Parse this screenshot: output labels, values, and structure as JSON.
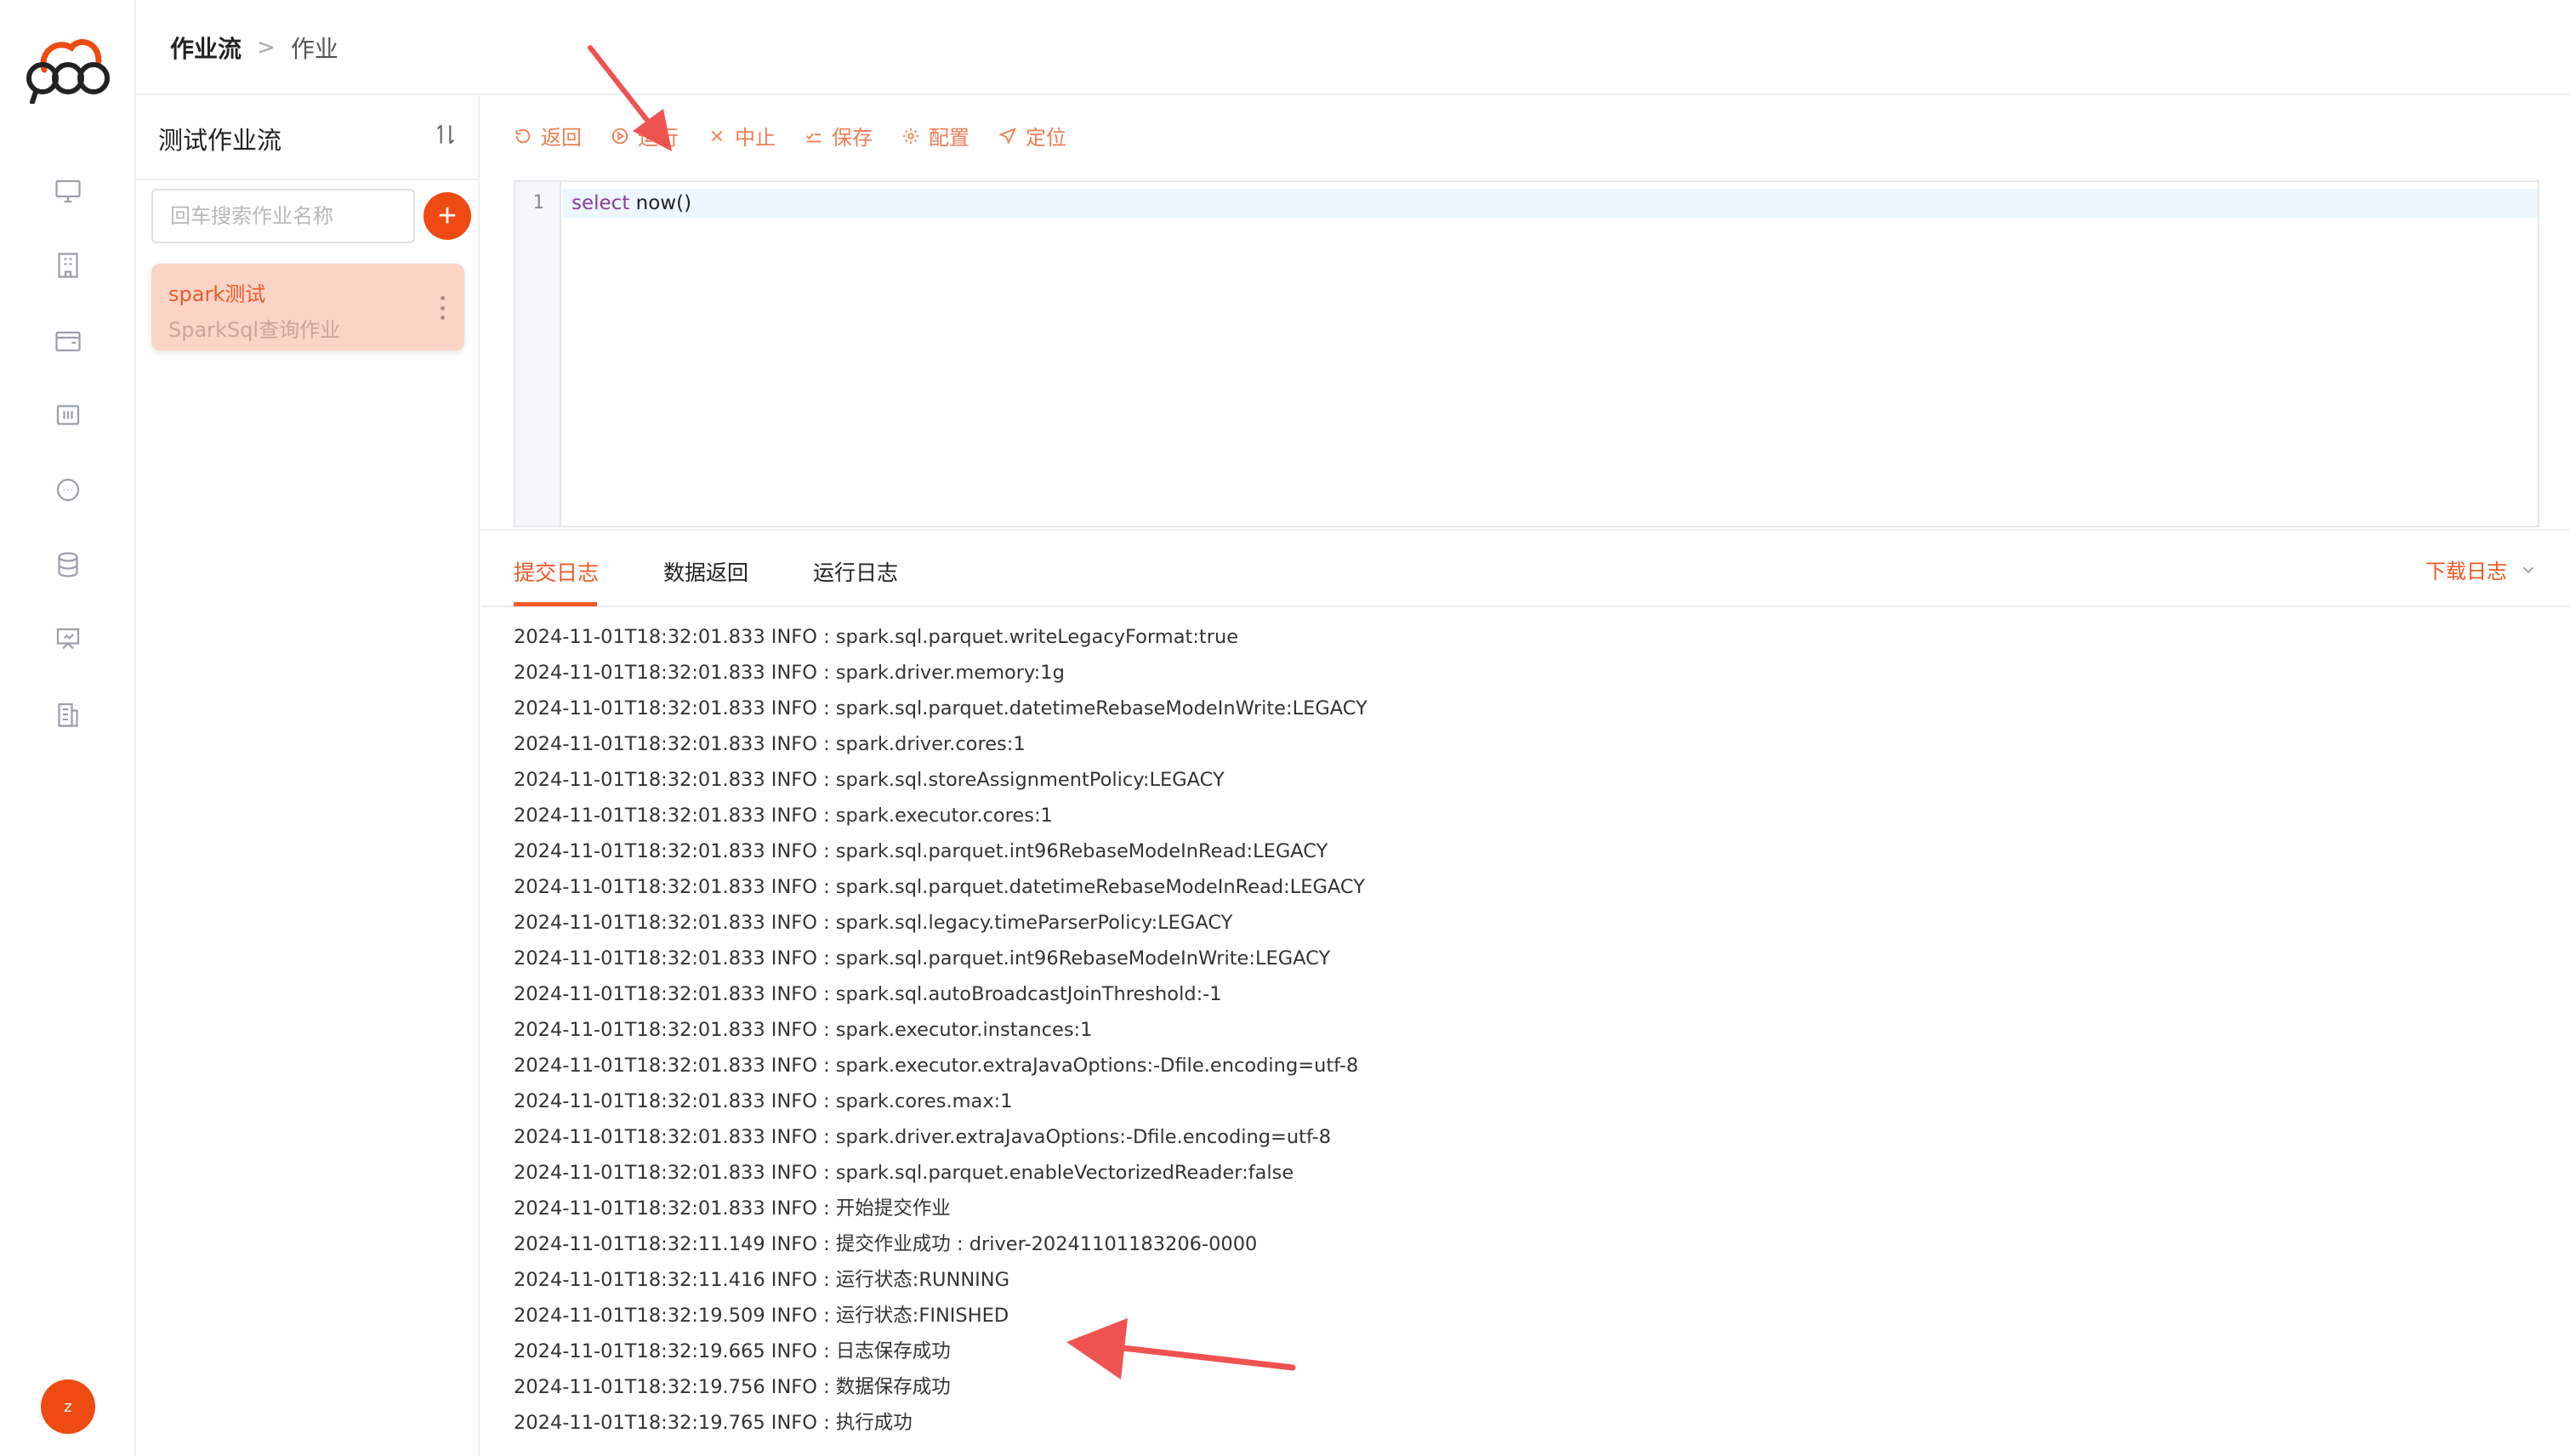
{
  "header": {
    "breadcrumb_root": "作业流",
    "breadcrumb_current": "作业"
  },
  "flow": {
    "title": "测试作业流",
    "search_placeholder": "回车搜索作业名称",
    "jobs": [
      {
        "name": "spark测试",
        "type": "SparkSql查询作业"
      }
    ]
  },
  "toolbar": {
    "back": "返回",
    "run": "运行",
    "stop": "中止",
    "save": "保存",
    "config": "配置",
    "locate": "定位"
  },
  "editor": {
    "line_number": "1",
    "keyword": "select",
    "rest": " now()"
  },
  "tabs": {
    "submit_log": "提交日志",
    "data_return": "数据返回",
    "run_log": "运行日志",
    "download": "下载日志"
  },
  "log": [
    "2024-11-01T18:32:01.833 INFO  : spark.sql.parquet.writeLegacyFormat:true",
    "2024-11-01T18:32:01.833 INFO  : spark.driver.memory:1g",
    "2024-11-01T18:32:01.833 INFO  : spark.sql.parquet.datetimeRebaseModeInWrite:LEGACY",
    "2024-11-01T18:32:01.833 INFO  : spark.driver.cores:1",
    "2024-11-01T18:32:01.833 INFO  : spark.sql.storeAssignmentPolicy:LEGACY",
    "2024-11-01T18:32:01.833 INFO  : spark.executor.cores:1",
    "2024-11-01T18:32:01.833 INFO  : spark.sql.parquet.int96RebaseModeInRead:LEGACY",
    "2024-11-01T18:32:01.833 INFO  : spark.sql.parquet.datetimeRebaseModeInRead:LEGACY",
    "2024-11-01T18:32:01.833 INFO  : spark.sql.legacy.timeParserPolicy:LEGACY",
    "2024-11-01T18:32:01.833 INFO  : spark.sql.parquet.int96RebaseModeInWrite:LEGACY",
    "2024-11-01T18:32:01.833 INFO  : spark.sql.autoBroadcastJoinThreshold:-1",
    "2024-11-01T18:32:01.833 INFO  : spark.executor.instances:1",
    "2024-11-01T18:32:01.833 INFO  : spark.executor.extraJavaOptions:-Dfile.encoding=utf-8",
    "2024-11-01T18:32:01.833 INFO  : spark.cores.max:1",
    "2024-11-01T18:32:01.833 INFO  : spark.driver.extraJavaOptions:-Dfile.encoding=utf-8",
    "2024-11-01T18:32:01.833 INFO  : spark.sql.parquet.enableVectorizedReader:false",
    "2024-11-01T18:32:01.833 INFO  : 开始提交作业",
    "2024-11-01T18:32:11.149 INFO  : 提交作业成功 : driver-20241101183206-0000",
    "2024-11-01T18:32:11.416 INFO  : 运行状态:RUNNING",
    "2024-11-01T18:32:19.509 INFO  : 运行状态:FINISHED",
    "2024-11-01T18:32:19.665 INFO  : 日志保存成功",
    "2024-11-01T18:32:19.756 INFO  : 数据保存成功",
    "2024-11-01T18:32:19.765 INFO  : 执行成功"
  ],
  "user": {
    "avatar_letter": "z"
  },
  "colors": {
    "accent": "#ef4a12",
    "accent_text": "#ee7e54",
    "card_bg": "#fbd4c6",
    "annotation_arrow": "#ef5350"
  }
}
